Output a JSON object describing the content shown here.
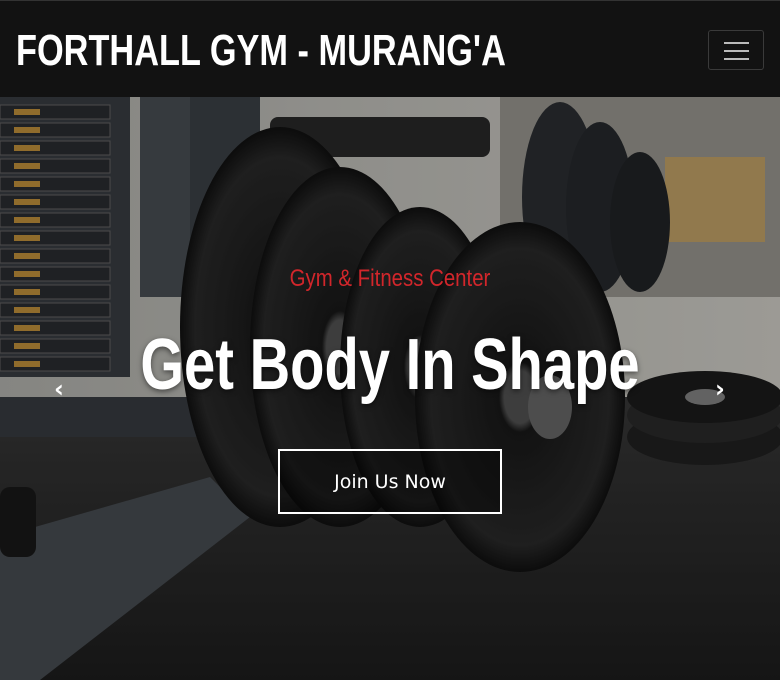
{
  "navbar": {
    "brand": "FORTHALL GYM - MURANG'A",
    "menu_icon": "hamburger-menu-icon"
  },
  "hero": {
    "kicker": "Gym & Fitness Center",
    "headline": "Get Body In Shape",
    "cta_label": "Join Us Now",
    "prev_icon": "chevron-left-icon",
    "next_icon": "chevron-right-icon"
  },
  "colors": {
    "navbar_bg": "#121212",
    "accent_red": "#d2262b",
    "text_white": "#ffffff"
  }
}
